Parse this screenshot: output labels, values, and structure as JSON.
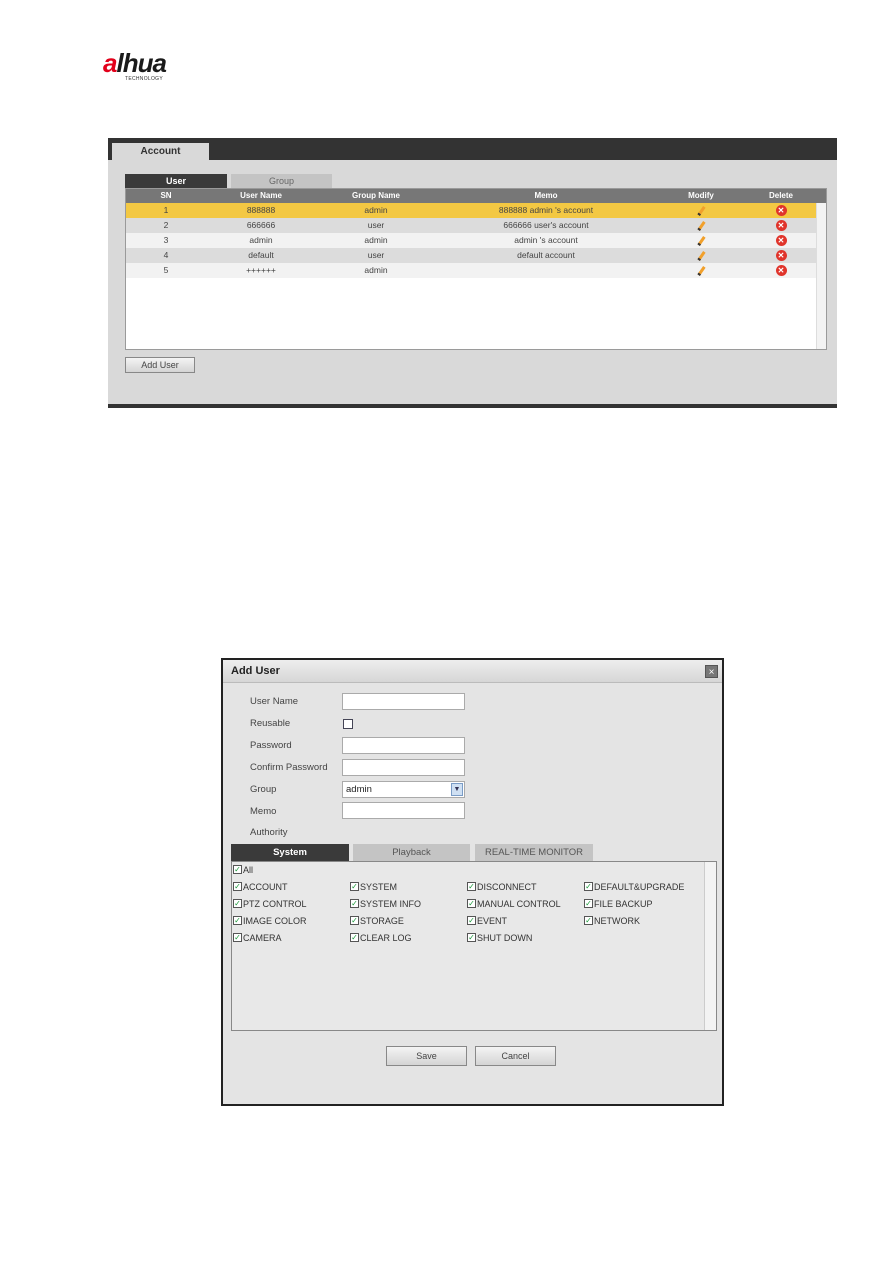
{
  "logo": {
    "brand": "alhua",
    "tagline": "TECHNOLOGY"
  },
  "account": {
    "main_tab": "Account",
    "sub_tabs": [
      "User",
      "Group"
    ],
    "columns": [
      "SN",
      "User Name",
      "Group Name",
      "Memo",
      "Modify",
      "Delete"
    ],
    "rows": [
      {
        "sn": "1",
        "user": "888888",
        "group": "admin",
        "memo": "888888 admin 's account",
        "selected": true
      },
      {
        "sn": "2",
        "user": "666666",
        "group": "user",
        "memo": "666666 user's account",
        "selected": false
      },
      {
        "sn": "3",
        "user": "admin",
        "group": "admin",
        "memo": "admin 's account",
        "selected": false
      },
      {
        "sn": "4",
        "user": "default",
        "group": "user",
        "memo": "default account",
        "selected": false
      },
      {
        "sn": "5",
        "user": "++++++",
        "group": "admin",
        "memo": "",
        "selected": false
      }
    ],
    "add_user_label": "Add User",
    "selected_row_color": "#f3c843"
  },
  "dialog": {
    "title": "Add User",
    "close": "×",
    "labels": {
      "user_name": "User Name",
      "reusable": "Reusable",
      "password": "Password",
      "confirm_password": "Confirm Password",
      "group": "Group",
      "memo": "Memo",
      "authority": "Authority"
    },
    "values": {
      "user_name": "",
      "password": "",
      "confirm_password": "",
      "group": "admin",
      "memo": ""
    },
    "reusable_checked": false,
    "tabs": [
      "System",
      "Playback",
      "REAL-TIME MONITOR"
    ],
    "all_label": "All",
    "authorities": [
      [
        "ACCOUNT",
        "SYSTEM",
        "DISCONNECT",
        "DEFAULT&UPGRADE"
      ],
      [
        "PTZ CONTROL",
        "SYSTEM INFO",
        "MANUAL CONTROL",
        "FILE BACKUP"
      ],
      [
        "IMAGE COLOR",
        "STORAGE",
        "EVENT",
        "NETWORK"
      ],
      [
        "CAMERA",
        "CLEAR LOG",
        "SHUT DOWN"
      ]
    ],
    "all_checked": true,
    "save_label": "Save",
    "cancel_label": "Cancel"
  }
}
